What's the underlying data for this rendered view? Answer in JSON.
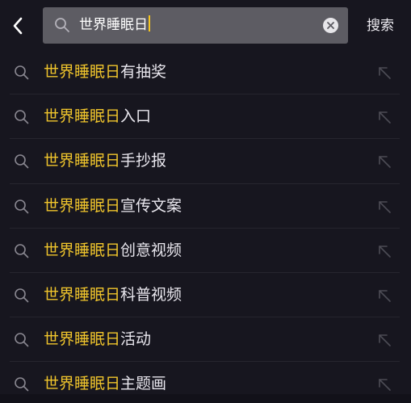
{
  "search": {
    "query": "世界睡眠日",
    "button_label": "搜索"
  },
  "suggestions": [
    {
      "highlight": "世界睡眠日",
      "rest": "有抽奖"
    },
    {
      "highlight": "世界睡眠日",
      "rest": "入口"
    },
    {
      "highlight": "世界睡眠日",
      "rest": "手抄报"
    },
    {
      "highlight": "世界睡眠日",
      "rest": "宣传文案"
    },
    {
      "highlight": "世界睡眠日",
      "rest": "创意视频"
    },
    {
      "highlight": "世界睡眠日",
      "rest": "科普视频"
    },
    {
      "highlight": "世界睡眠日",
      "rest": "活动"
    },
    {
      "highlight": "世界睡眠日",
      "rest": "主题画"
    }
  ],
  "icons": {
    "back": "chevron-left-icon",
    "search": "search-icon",
    "clear": "clear-icon",
    "fill": "arrow-up-left-icon"
  },
  "colors": {
    "background": "#17161f",
    "search_box": "#5d5c63",
    "highlight": "#f0c52c",
    "text": "#e9e7ee",
    "caret": "#f6c51e"
  }
}
